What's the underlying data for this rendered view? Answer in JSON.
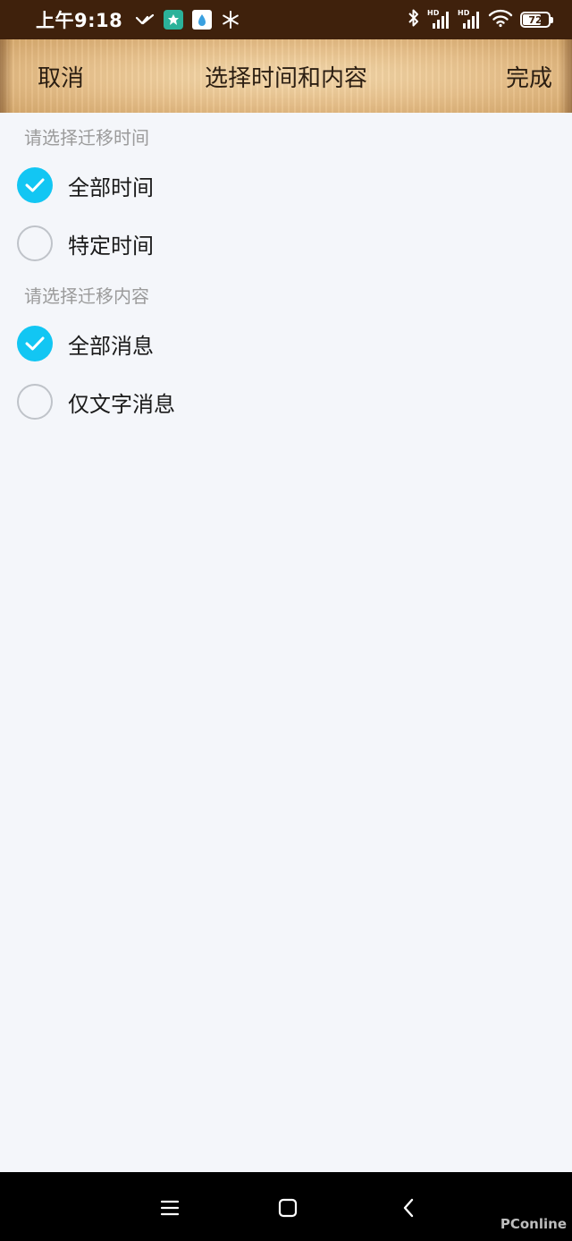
{
  "status_bar": {
    "time": "上午9:18",
    "battery": "72",
    "battery_level": 0.72,
    "hd1": "HD",
    "hd2": "HD",
    "icons": [
      "check-mark-icon",
      "green-app-icon",
      "white-app-icon",
      "snowflake-icon",
      "bluetooth-icon",
      "signal-hd-icon",
      "signal-hd-icon",
      "wifi-icon",
      "battery-icon"
    ]
  },
  "header": {
    "cancel_label": "取消",
    "title": "选择时间和内容",
    "done_label": "完成"
  },
  "sections": {
    "time_header": "请选择迁移时间",
    "content_header": "请选择迁移内容"
  },
  "options": {
    "all_time": {
      "label": "全部时间",
      "checked": true
    },
    "specific_time": {
      "label": "特定时间",
      "checked": false
    },
    "all_messages": {
      "label": "全部消息",
      "checked": true
    },
    "text_only": {
      "label": "仅文字消息",
      "checked": false
    }
  },
  "colors": {
    "status_bg": "#3f210c",
    "accent": "#12c6f3",
    "page_bg": "#f4f6fa",
    "header_wood": "#e9c28c"
  },
  "nav_bar": {
    "icons": [
      "menu-icon",
      "home-icon",
      "back-icon"
    ]
  },
  "watermark": "PConline"
}
